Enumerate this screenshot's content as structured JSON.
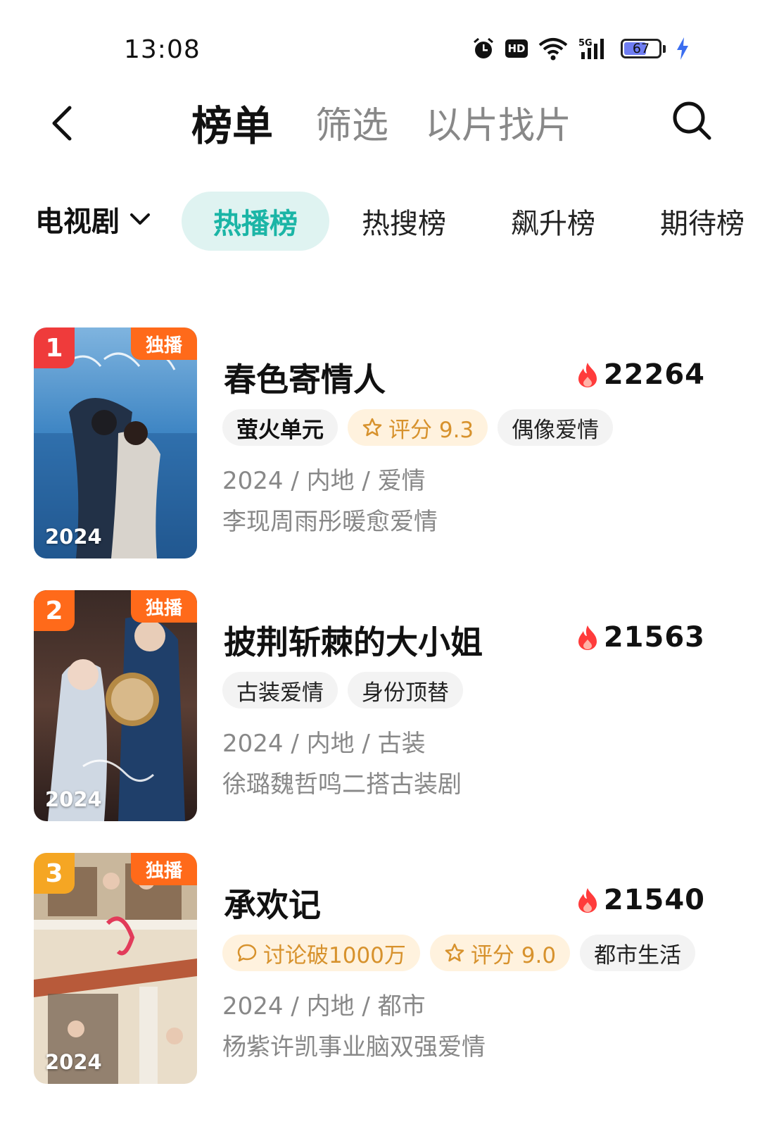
{
  "status_bar": {
    "time": "13:08",
    "battery_level": "67",
    "hd_label": "HD",
    "network_label": "5G"
  },
  "header": {
    "tabs": [
      "榜单",
      "筛选",
      "以片找片"
    ]
  },
  "categories": {
    "selected": "电视剧",
    "tabs": [
      "热播榜",
      "热搜榜",
      "飙升榜",
      "期待榜"
    ]
  },
  "items": [
    {
      "rank": "1",
      "badge": "独播",
      "year_badge": "2024",
      "title": "春色寄情人",
      "heat": "22264",
      "tags": [
        {
          "label": "萤火单元",
          "style": "brand"
        },
        {
          "label": "评分 9.3",
          "style": "gold",
          "icon": "star-icon"
        },
        {
          "label": "偶像爱情",
          "style": "plain"
        }
      ],
      "meta": "2024 / 内地 / 爱情",
      "desc": "李现周雨彤暖愈爱情",
      "rank_color": "#ef3b3b"
    },
    {
      "rank": "2",
      "badge": "独播",
      "year_badge": "2024",
      "title": "披荆斩棘的大小姐",
      "heat": "21563",
      "tags": [
        {
          "label": "古装爱情",
          "style": "plain"
        },
        {
          "label": "身份顶替",
          "style": "plain"
        }
      ],
      "meta": "2024 / 内地 / 古装",
      "desc": "徐璐魏哲鸣二搭古装剧",
      "rank_color": "#ff6a1a"
    },
    {
      "rank": "3",
      "badge": "独播",
      "year_badge": "2024",
      "title": "承欢记",
      "heat": "21540",
      "tags": [
        {
          "label": "讨论破1000万",
          "style": "gold",
          "icon": "comment-icon"
        },
        {
          "label": "评分 9.0",
          "style": "gold",
          "icon": "star-icon"
        },
        {
          "label": "都市生活",
          "style": "plain"
        }
      ],
      "meta": "2024 / 内地 / 都市",
      "desc": "杨紫许凯事业脑双强爱情",
      "rank_color": "#f5a623"
    }
  ]
}
